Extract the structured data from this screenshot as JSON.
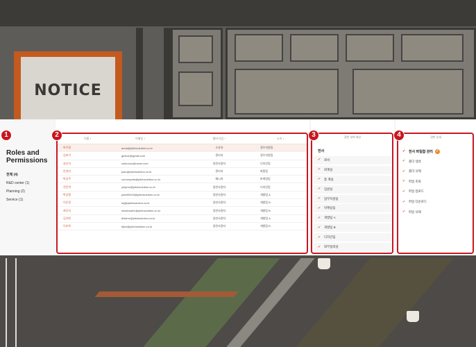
{
  "background": {
    "notice_text": "NOTICE"
  },
  "sidebar": {
    "title": "Roles and Permissions",
    "groups": [
      {
        "label": "전체 (4)"
      },
      {
        "label": "R&D center (1)"
      },
      {
        "label": "Planning (2)"
      },
      {
        "label": "Service (1)"
      }
    ]
  },
  "members_table": {
    "headers": [
      "이름 ↕",
      "이메일 ↕",
      "멤버 타입 ↕",
      "소속 ↕"
    ],
    "rows": [
      [
        "박주환",
        "anna@pitchsolution.co.kr",
        "소유자",
        "경우지원팀"
      ],
      [
        "김초이",
        "girlsoe@gmail.com",
        "관리자",
        "경우지원팀"
      ],
      [
        "송유히",
        "owhoooo@naver.com",
        "일반사용자",
        "디자인팀"
      ],
      [
        "안영지",
        "joan@pitchsolution.co.kr",
        "관리자",
        "회원팀"
      ],
      [
        "박공주",
        "connorpark@pitchsolution.co.kr",
        "매니저",
        "마케팅팀"
      ],
      [
        "전윤역",
        "ymjeon@pitchsolution.co.kr",
        "일반사용자",
        "디자인팀"
      ],
      [
        "박상철",
        "park90443@pitchsolution.co.kr",
        "일반사용자",
        "개발팀 A"
      ],
      [
        "이은정",
        "lwj@pitchsolution.co.kr",
        "일반사용자",
        "개발팀 B"
      ],
      [
        "최은지",
        "wholesale1@pitchsolution.co.kr",
        "일반사용자",
        "개발팀 B"
      ],
      [
        "김아현",
        "dhkimv@pitchsolution.co.kr",
        "일반사용자",
        "개발팀 A"
      ],
      [
        "이호북",
        "hjbw@pitchsolution.co.kr",
        "일반사용자",
        "개발팀 B"
      ]
    ],
    "selected_row": 0
  },
  "targets": {
    "header": "권한 부여 대상",
    "items": [
      "전사",
      "로비",
      "회계실",
      "총 계실",
      "임원실",
      "업무지원팀",
      "마케팅팀",
      "개발팀 A",
      "개발팀 B",
      "디자인팀",
      "외부협력실"
    ]
  },
  "permissions": {
    "header": "권한 상세",
    "items": [
      "전사 파일함 관리",
      "폴더 생성",
      "폴더 삭제",
      "파일 조회",
      "파일 업로드",
      "파일 다운로드",
      "파일 삭제"
    ]
  },
  "callouts": [
    "1",
    "2",
    "3",
    "4"
  ],
  "colors": {
    "accent": "#c8161f",
    "check": "#e06040",
    "badge_orange": "#f08a2a"
  }
}
